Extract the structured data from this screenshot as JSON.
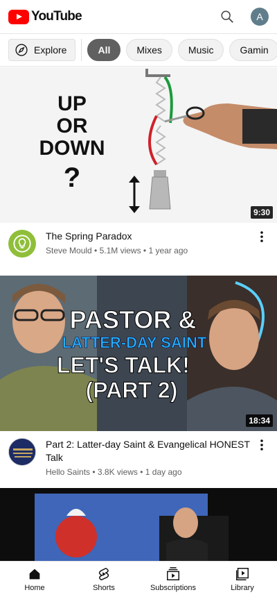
{
  "app": {
    "logo_text": "YouTube",
    "account_initial": "A"
  },
  "chips": {
    "explore_label": "Explore",
    "items": [
      "All",
      "Mixes",
      "Music",
      "Gamin"
    ]
  },
  "videos": [
    {
      "thumb_text": [
        "UP",
        "OR",
        "DOWN",
        "?"
      ],
      "duration": "9:30",
      "title": "The Spring Paradox",
      "channel": "Steve Mould",
      "stats": "5.1M views • 1 year ago"
    },
    {
      "thumb_text": [
        "PASTOR &",
        "LATTER-DAY SAINT",
        "LET'S TALK!",
        "(PART 2)"
      ],
      "duration": "18:34",
      "title": "Part 2: Latter-day Saint & Evangelical HONEST Talk",
      "channel": "Hello Saints",
      "stats": "3.8K views • 1 day ago"
    }
  ],
  "bottom_nav": [
    {
      "label": "Home"
    },
    {
      "label": "Shorts"
    },
    {
      "label": "Subscriptions"
    },
    {
      "label": "Library"
    }
  ],
  "colors": {
    "brand_red": "#ff0000",
    "chip_active": "#606060"
  }
}
